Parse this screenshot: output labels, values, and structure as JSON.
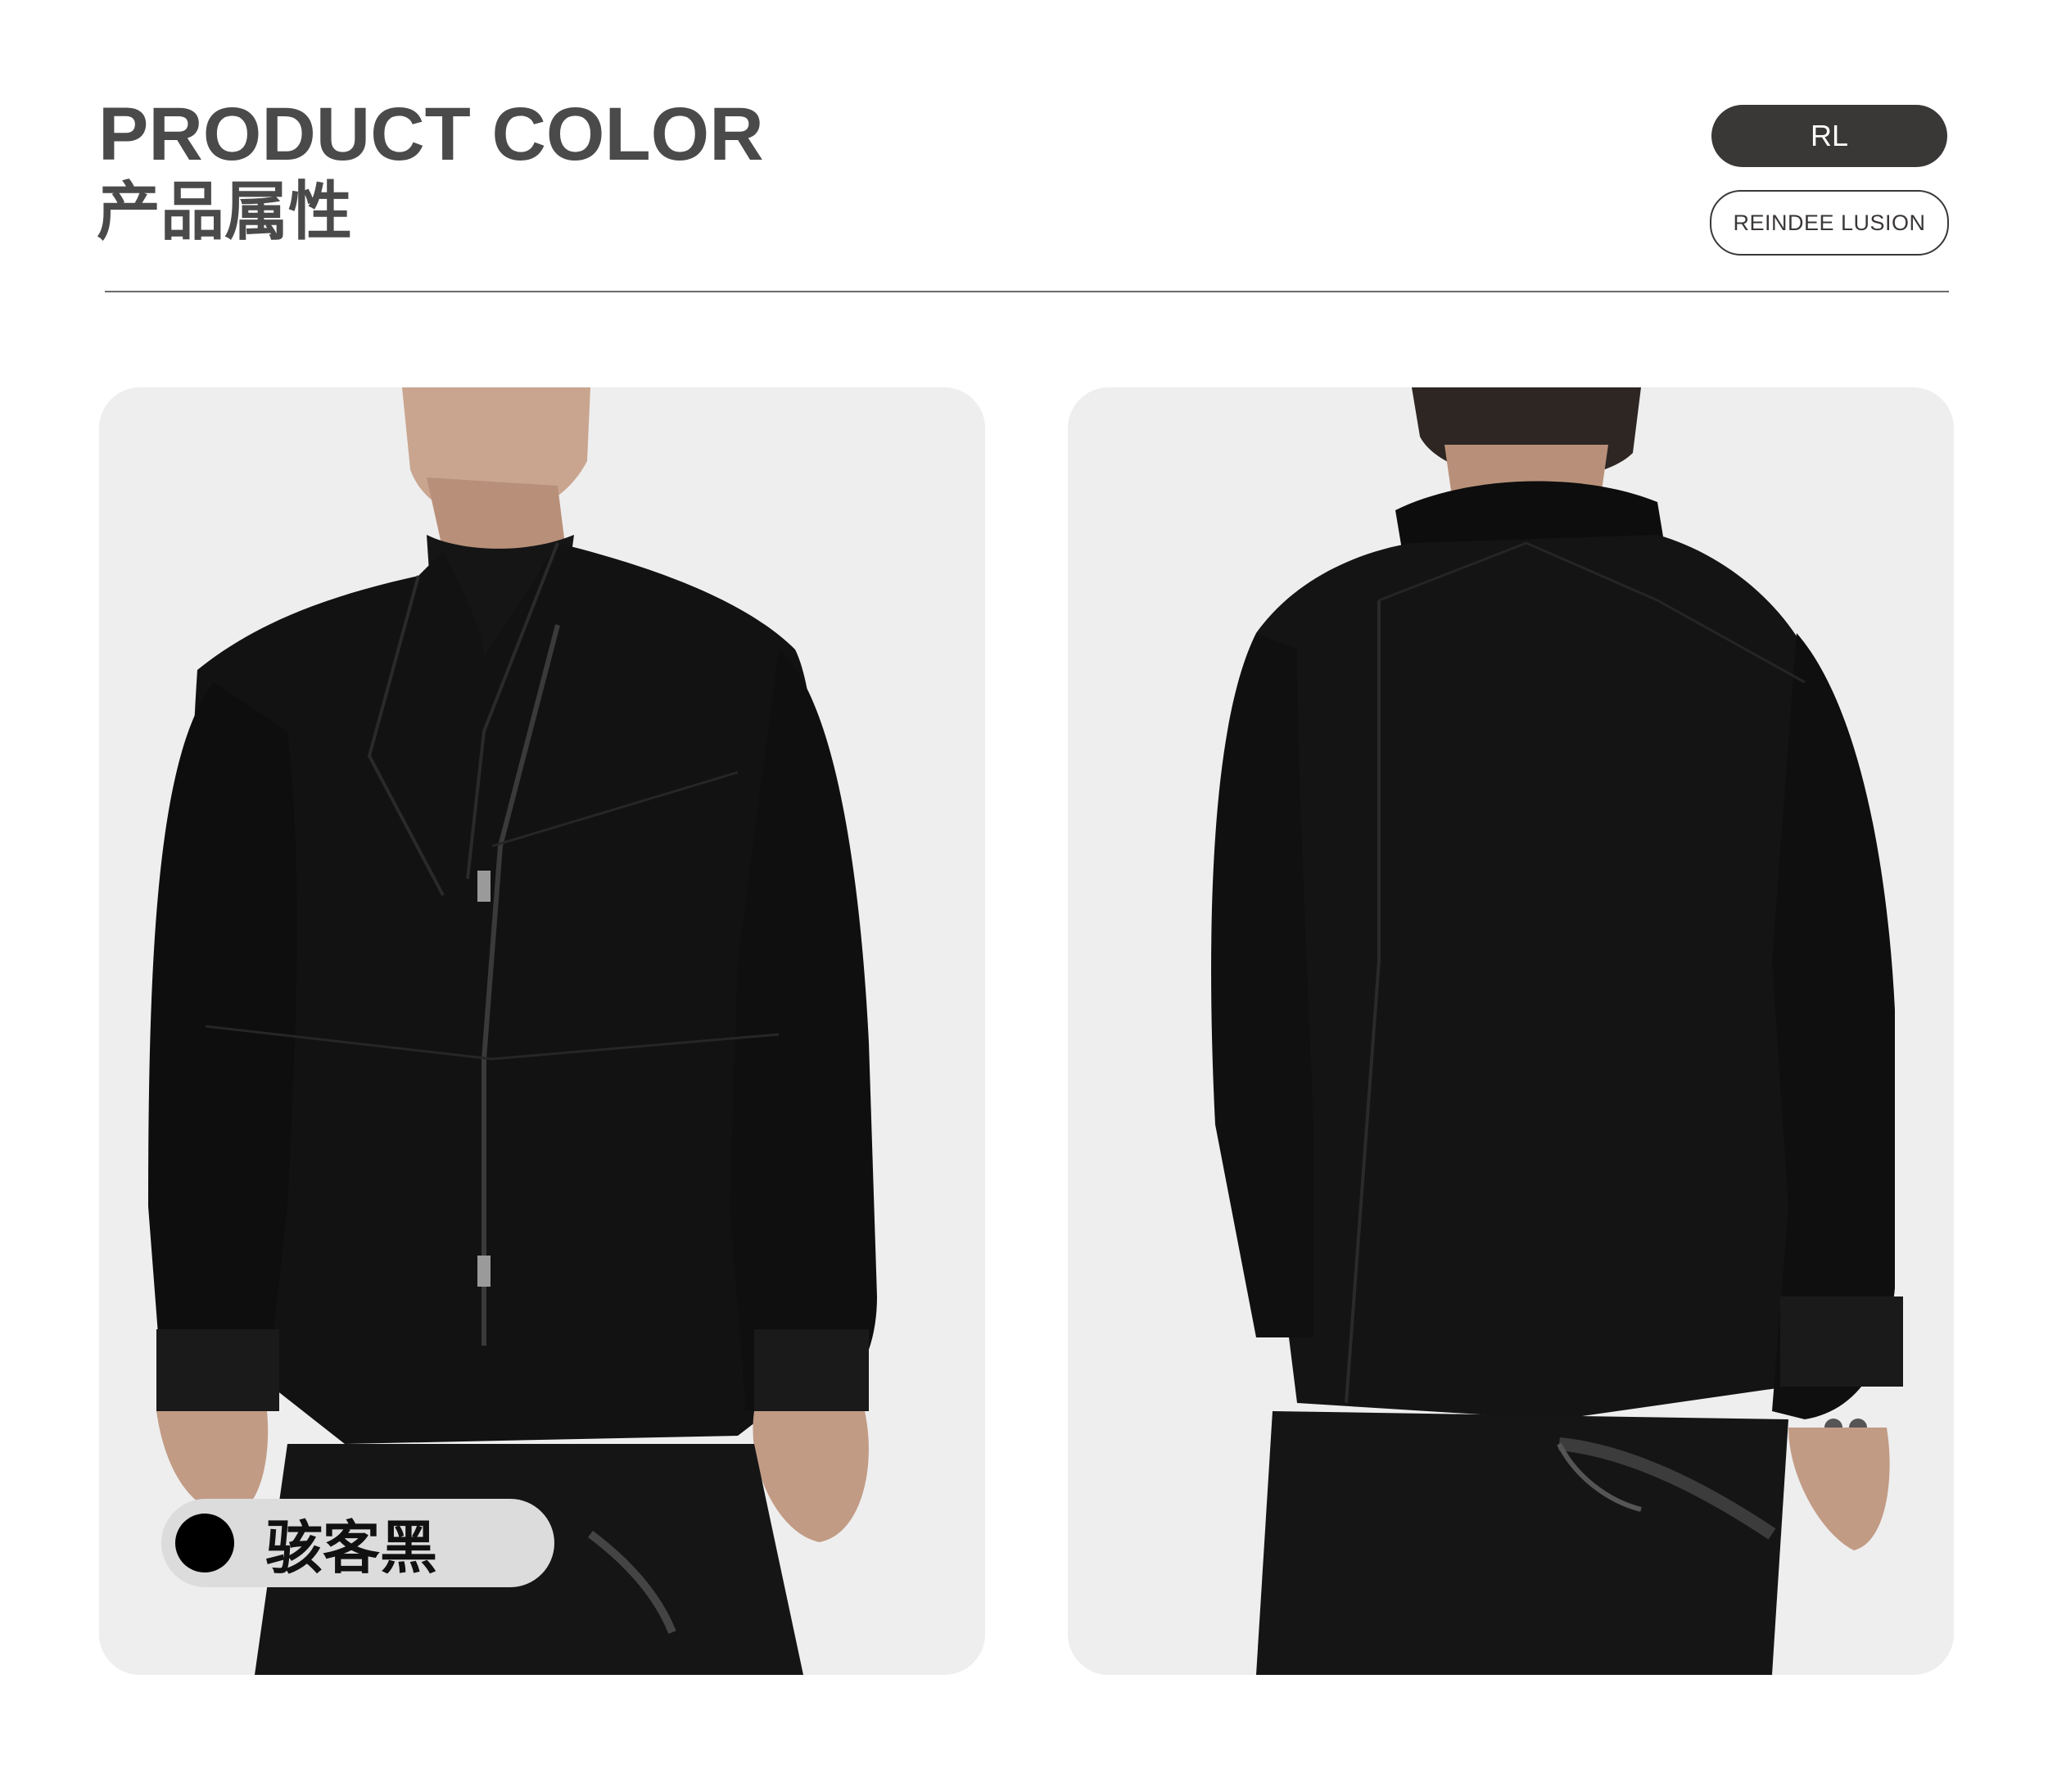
{
  "header": {
    "title_en": "PRODUCT COLOR",
    "title_cn": "产品属性",
    "brand_short": "RL",
    "brand_full": "REINDEE LUSION"
  },
  "photos": [
    {
      "view": "front",
      "description_icon": "model-front-jacket"
    },
    {
      "view": "back",
      "description_icon": "model-back-jacket"
    }
  ],
  "swatch": {
    "label": "骇客黑",
    "color": "#000000"
  },
  "colors": {
    "title": "#4a4a4a",
    "pill": "#3a3737",
    "panel": "#eeeeee",
    "chip": "#dcdcdc"
  }
}
